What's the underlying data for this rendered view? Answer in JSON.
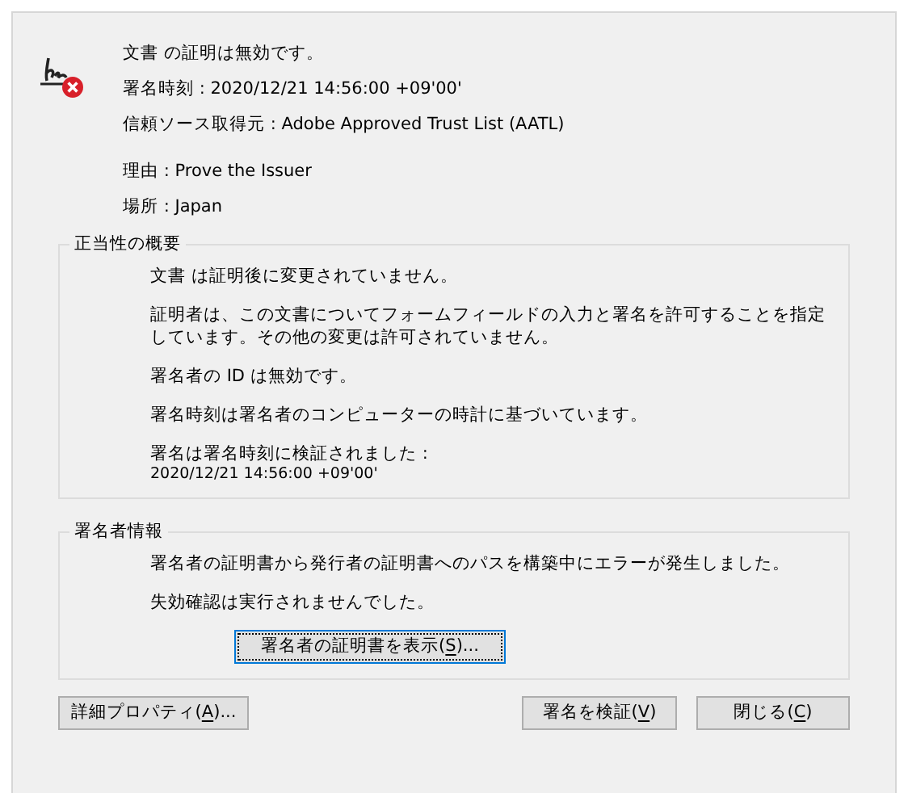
{
  "status": {
    "title": "文書 の証明は無効です。",
    "fields": [
      {
        "label": "署名時刻 :",
        "value": "2020/12/21 14:56:00 +09'00'"
      },
      {
        "label": "信頼ソース取得元 :",
        "value": "Adobe Approved Trust List (AATL)"
      }
    ],
    "details": [
      {
        "label": "理由 :",
        "value": "Prove the Issuer"
      },
      {
        "label": "場所 :",
        "value": "Japan"
      }
    ]
  },
  "validity_summary": {
    "title": "正当性の概要",
    "messages": [
      "文書 は証明後に変更されていません。",
      "証明者は、この文書についてフォームフィールドの入力と署名を許可することを指定しています。その他の変更は許可されていません。",
      "署名者の ID は無効です。",
      "署名時刻は署名者のコンピューターの時計に基づいています。",
      "署名は署名時刻に検証されました :"
    ],
    "verified_time": "2020/12/21 14:56:00 +09'00'"
  },
  "signer_info": {
    "title": "署名者情報",
    "messages": [
      "署名者の証明書から発行者の証明書へのパスを構築中にエラーが発生しました。",
      "失効確認は実行されませんでした。"
    ],
    "button": {
      "label": "署名者の証明書を表示(",
      "access_key": "S",
      "suffix": ")...",
      "focused": true
    }
  },
  "buttons": [
    {
      "label": "詳細プロパティ(",
      "access_key": "A",
      "suffix": ")...",
      "focused": false
    },
    {
      "label": "署名を検証(",
      "access_key": "V",
      "suffix": ")",
      "focused": false
    },
    {
      "label": "閉じる(",
      "access_key": "C",
      "suffix": ")",
      "focused": false
    }
  ]
}
